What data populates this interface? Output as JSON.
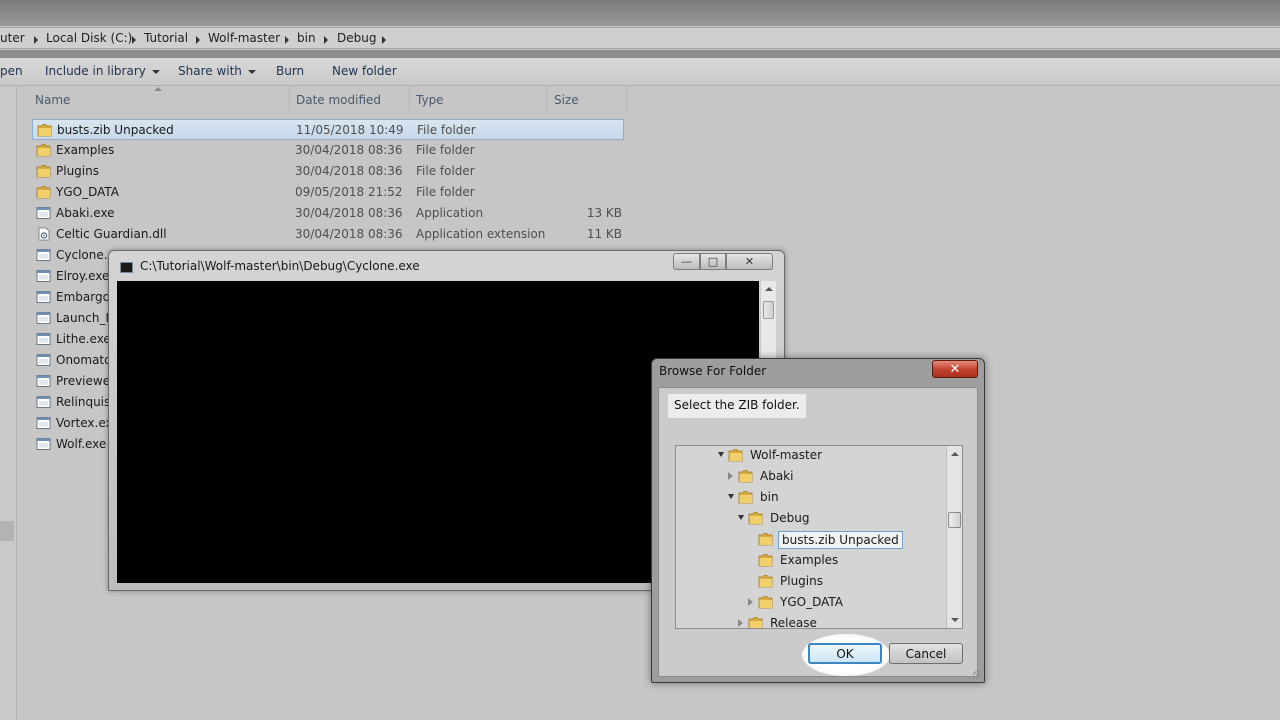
{
  "explorer": {
    "breadcrumb": [
      "uter",
      "Local Disk (C:)",
      "Tutorial",
      "Wolf-master",
      "bin",
      "Debug"
    ],
    "toolbar": {
      "open_label": "pen",
      "include_label": "Include in library",
      "share_label": "Share with",
      "burn_label": "Burn",
      "new_folder_label": "New folder"
    },
    "columns": {
      "name": "Name",
      "date": "Date modified",
      "type": "Type",
      "size": "Size"
    },
    "files": [
      {
        "name": "busts.zib Unpacked",
        "date": "11/05/2018 10:49",
        "type": "File folder",
        "size": "",
        "icon": "folder-icon",
        "selected": true
      },
      {
        "name": "Examples",
        "date": "30/04/2018 08:36",
        "type": "File folder",
        "size": "",
        "icon": "folder-icon"
      },
      {
        "name": "Plugins",
        "date": "30/04/2018 08:36",
        "type": "File folder",
        "size": "",
        "icon": "folder-icon"
      },
      {
        "name": "YGO_DATA",
        "date": "09/05/2018 21:52",
        "type": "File folder",
        "size": "",
        "icon": "folder-icon"
      },
      {
        "name": "Abaki.exe",
        "date": "30/04/2018 08:36",
        "type": "Application",
        "size": "13 KB",
        "icon": "application-icon"
      },
      {
        "name": "Celtic Guardian.dll",
        "date": "30/04/2018 08:36",
        "type": "Application extension",
        "size": "11 KB",
        "icon": "dll-icon"
      },
      {
        "name": "Cyclone.exe",
        "date": "",
        "type": "",
        "size": "",
        "icon": "application-icon"
      },
      {
        "name": "Elroy.exe",
        "date": "",
        "type": "",
        "size": "",
        "icon": "application-icon"
      },
      {
        "name": "Embargo.exe",
        "date": "",
        "type": "",
        "size": "",
        "icon": "application-icon"
      },
      {
        "name": "Launch_Lo",
        "date": "",
        "type": "",
        "size": "",
        "icon": "application-icon"
      },
      {
        "name": "Lithe.exe",
        "date": "",
        "type": "",
        "size": "",
        "icon": "application-icon"
      },
      {
        "name": "Onomatopaira.exe",
        "date": "",
        "type": "",
        "size": "",
        "icon": "application-icon"
      },
      {
        "name": "Previewer.exe",
        "date": "",
        "type": "",
        "size": "",
        "icon": "application-icon"
      },
      {
        "name": "Relinquished.exe",
        "date": "",
        "type": "",
        "size": "",
        "icon": "application-icon"
      },
      {
        "name": "Vortex.exe",
        "date": "",
        "type": "",
        "size": "",
        "icon": "application-icon"
      },
      {
        "name": "Wolf.exe",
        "date": "",
        "type": "",
        "size": "",
        "icon": "application-icon"
      }
    ]
  },
  "console": {
    "title": "C:\\Tutorial\\Wolf-master\\bin\\Debug\\Cyclone.exe",
    "minimize_glyph": "—",
    "maximize_glyph": "□",
    "close_glyph": "✕"
  },
  "browse": {
    "title": "Browse For Folder",
    "close_glyph": "✕",
    "prompt": "Select the ZIB folder.",
    "tree": [
      {
        "label": "Wolf-master",
        "twisty": "expanded"
      },
      {
        "label": "Abaki",
        "twisty": "collapsed"
      },
      {
        "label": "bin",
        "twisty": "expanded"
      },
      {
        "label": "Debug",
        "twisty": "expanded"
      },
      {
        "label": "busts.zib Unpacked",
        "twisty": "none",
        "selected": true
      },
      {
        "label": "Examples",
        "twisty": "none"
      },
      {
        "label": "Plugins",
        "twisty": "none"
      },
      {
        "label": "YGO_DATA",
        "twisty": "collapsed"
      },
      {
        "label": "Release",
        "twisty": "collapsed"
      }
    ],
    "ok_label": "OK",
    "cancel_label": "Cancel"
  },
  "colors": {
    "selection_border": "#8eaecd",
    "ok_border": "#3c86c4",
    "close_red": "#c0402a",
    "folder_yellow": "#e8c25a"
  }
}
